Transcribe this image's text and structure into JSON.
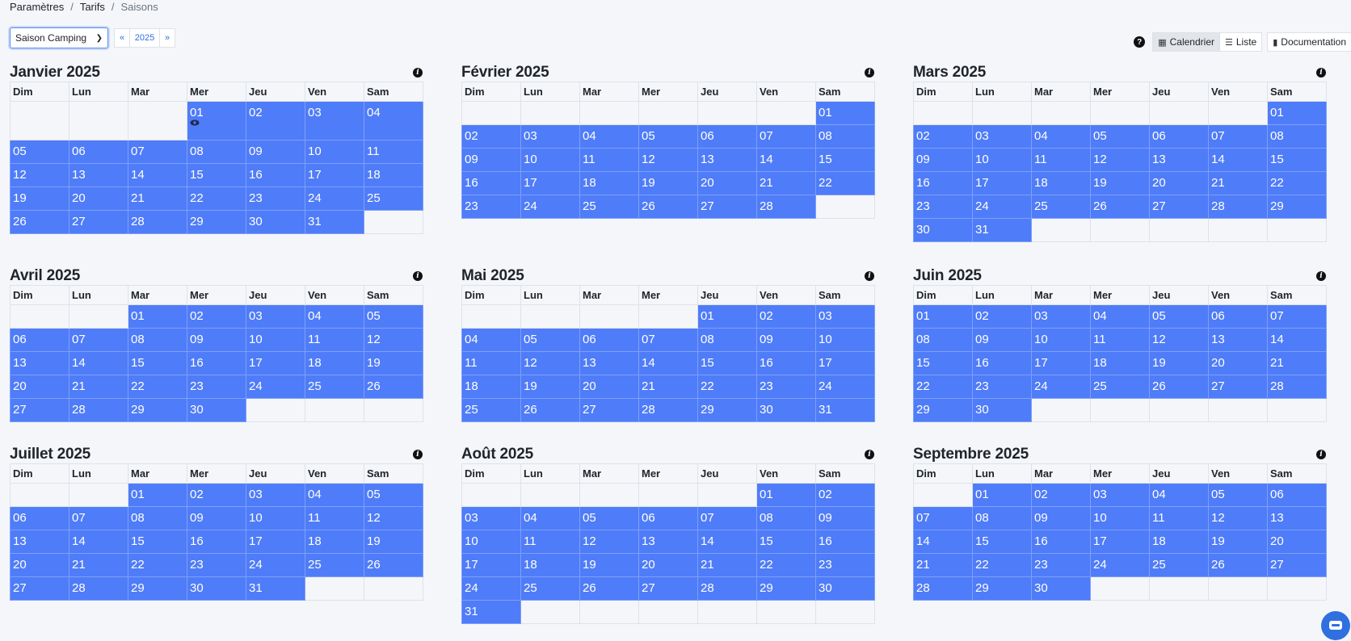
{
  "breadcrumb": [
    "Paramètres",
    "Tarifs",
    "Saisons"
  ],
  "season_select": {
    "value": "Saison Camping"
  },
  "year_nav": {
    "prev": "«",
    "year": "2025",
    "next": "»"
  },
  "toolbar": {
    "help_icon": "question-circle-icon",
    "calendar_label": "Calendrier",
    "list_label": "Liste",
    "doc_label": "Documentation"
  },
  "weekdays": [
    "Dim",
    "Lun",
    "Mar",
    "Mer",
    "Jeu",
    "Ven",
    "Sam"
  ],
  "colors": {
    "season_day": "#4f7cf8",
    "background": "#f4f6fa",
    "accent": "#2f6fe0"
  },
  "months": [
    {
      "title": "Janvier 2025",
      "start": 3,
      "days": 31,
      "marked_day": 1
    },
    {
      "title": "Février 2025",
      "start": 6,
      "days": 28
    },
    {
      "title": "Mars 2025",
      "start": 6,
      "days": 31
    },
    {
      "title": "Avril 2025",
      "start": 2,
      "days": 30
    },
    {
      "title": "Mai 2025",
      "start": 4,
      "days": 31
    },
    {
      "title": "Juin 2025",
      "start": 0,
      "days": 30
    },
    {
      "title": "Juillet 2025",
      "start": 2,
      "days": 31
    },
    {
      "title": "Août 2025",
      "start": 5,
      "days": 31
    },
    {
      "title": "Septembre 2025",
      "start": 1,
      "days": 30
    }
  ]
}
